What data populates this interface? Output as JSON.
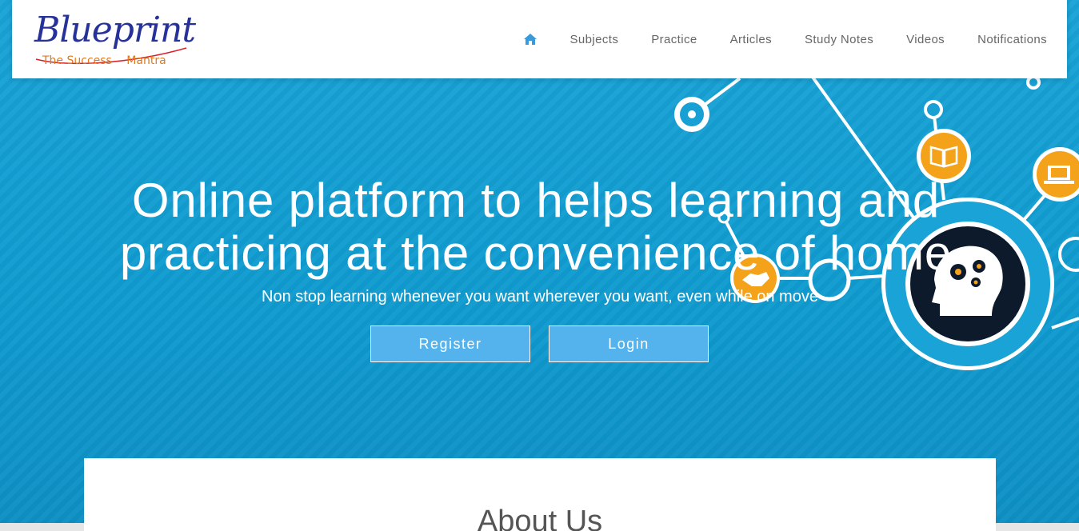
{
  "brand": {
    "name": "Blueprint",
    "tagline_left": "The Success",
    "tagline_right": "Mantra"
  },
  "nav": {
    "home_icon": "home-icon",
    "items": [
      "Subjects",
      "Practice",
      "Articles",
      "Study Notes",
      "Videos",
      "Notifications"
    ]
  },
  "hero": {
    "headline_line1": "Online platform to helps learning and",
    "headline_line2": "practicing at the convenience of home",
    "subline": "Non stop learning whenever you want wherever you want, even while on move",
    "register_label": "Register",
    "login_label": "Login",
    "illustration_icons": [
      "open-book-icon",
      "laptop-icon",
      "handshake-icon",
      "head-gears-icon"
    ]
  },
  "about": {
    "title": "About Us"
  },
  "colors": {
    "hero_blue": "#1aa3d6",
    "button_blue": "#54b3ec",
    "accent_orange": "#f5a21b",
    "nav_active": "#3a9bdc",
    "logo_red": "#d8232a",
    "logo_blue": "#26329a"
  }
}
